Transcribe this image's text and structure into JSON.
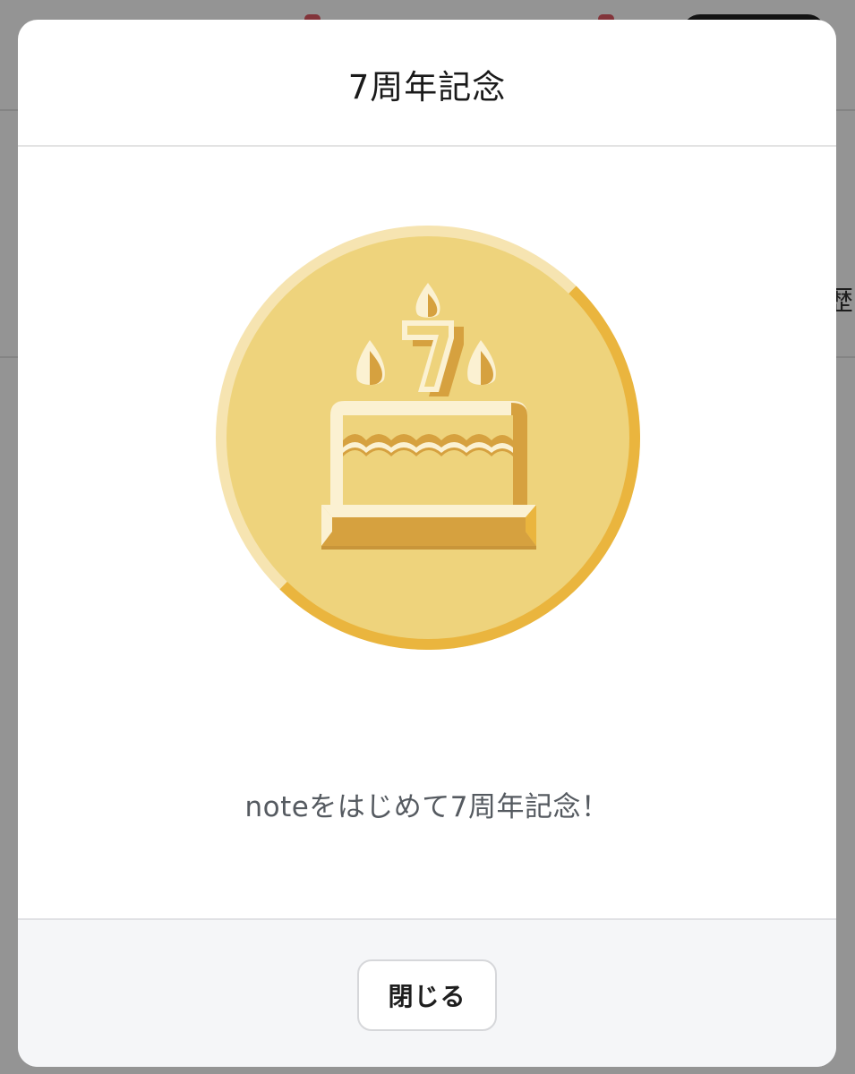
{
  "background_page": {
    "side_text": "歴"
  },
  "modal": {
    "title": "7周年記念",
    "badge": {
      "icon": "birthday-cake-icon",
      "number": "7",
      "colors": {
        "coin_face": "#EED37C",
        "coin_rim_light": "#F6E4B1",
        "coin_rim_dark": "#EAB53E",
        "cake_highlight": "#FBF1D2",
        "cake_shadow": "#D6A13F"
      }
    },
    "message": "noteをはじめて7周年記念！",
    "close_label": "閉じる"
  }
}
